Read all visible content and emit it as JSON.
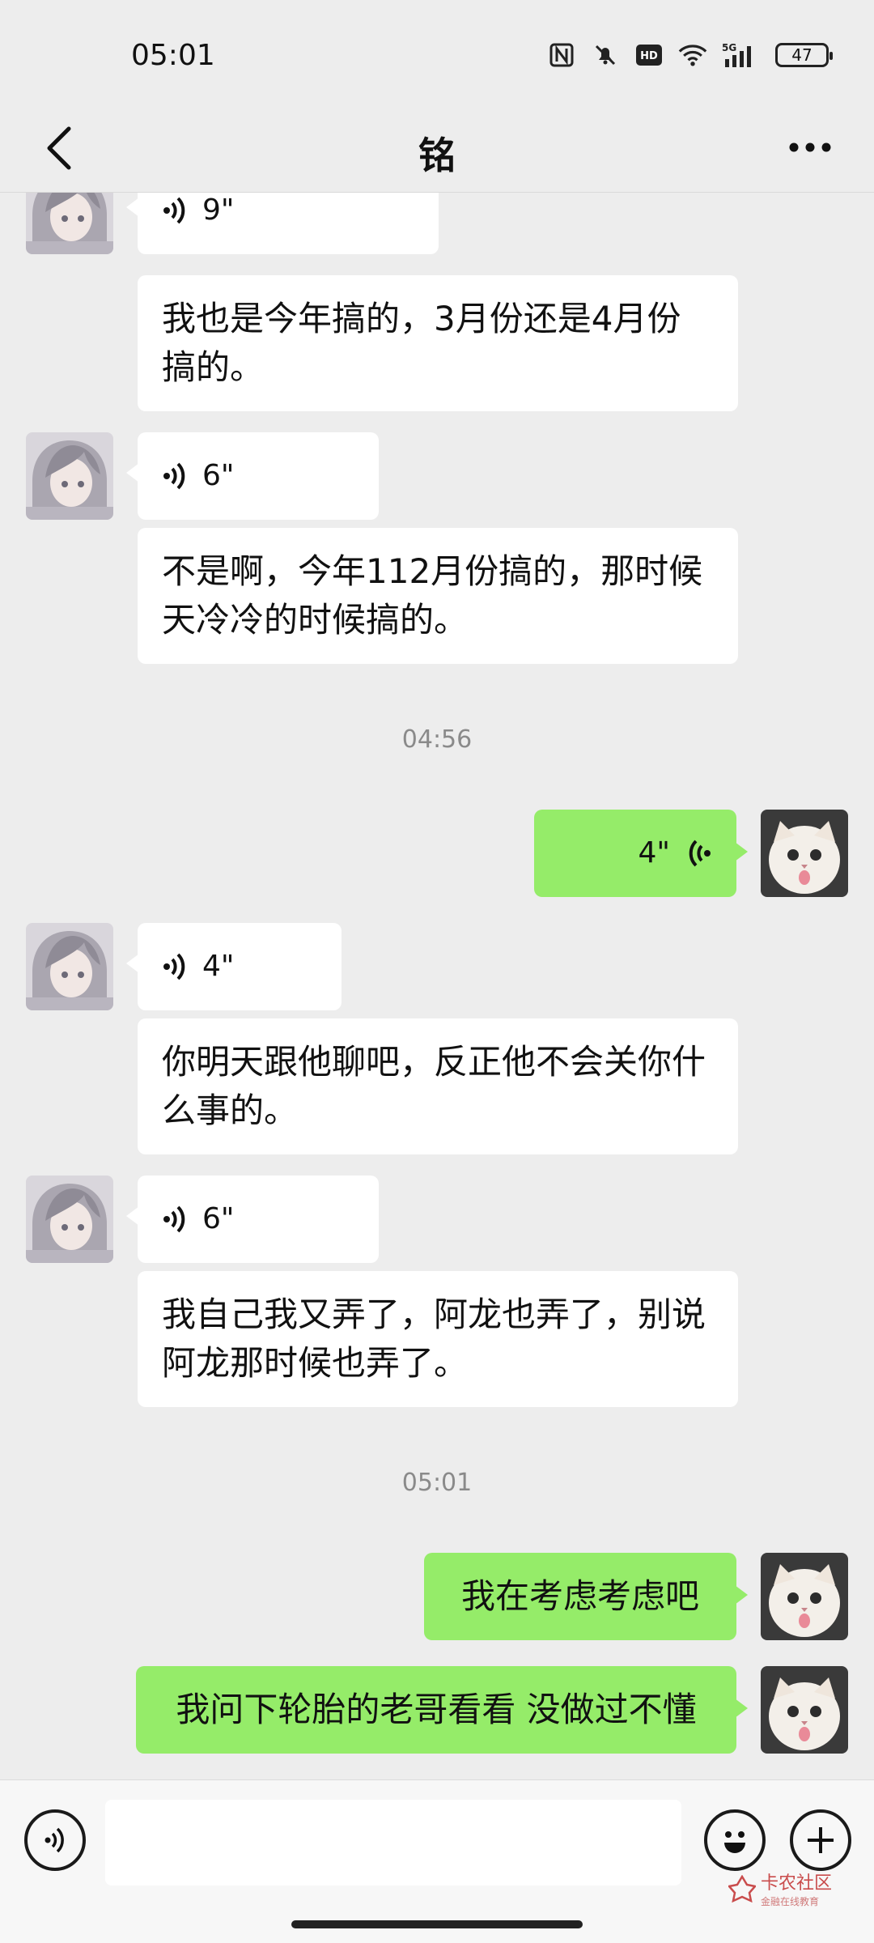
{
  "status_bar": {
    "time": "05:01",
    "battery": "47",
    "network": "5G",
    "icons": [
      "nfc-icon",
      "mute-icon",
      "hd-icon",
      "wifi-icon",
      "signal-icon",
      "battery-icon"
    ]
  },
  "header": {
    "title": "铭",
    "back_icon": "chevron-left-icon",
    "more_icon": "more-dots-icon"
  },
  "messages": [
    {
      "id": "m1",
      "side": "in",
      "type": "voice",
      "duration": "9\""
    },
    {
      "id": "m2",
      "side": "in",
      "type": "text",
      "text": "我也是今年搞的，3月份还是4月份搞的。"
    },
    {
      "id": "m3",
      "side": "in",
      "type": "voice",
      "duration": "6\""
    },
    {
      "id": "m4",
      "side": "in",
      "type": "text",
      "text": "不是啊，今年112月份搞的，那时候天冷冷的时候搞的。"
    },
    {
      "id": "t1",
      "type": "time",
      "text": "04:56"
    },
    {
      "id": "m5",
      "side": "out",
      "type": "voice",
      "duration": "4\""
    },
    {
      "id": "m6",
      "side": "in",
      "type": "voice",
      "duration": "4\""
    },
    {
      "id": "m7",
      "side": "in",
      "type": "text",
      "text": "你明天跟他聊吧，反正他不会关你什么事的。"
    },
    {
      "id": "m8",
      "side": "in",
      "type": "voice",
      "duration": "6\""
    },
    {
      "id": "m9",
      "side": "in",
      "type": "text",
      "text": "我自己我又弄了，阿龙也弄了，别说阿龙那时候也弄了。"
    },
    {
      "id": "t2",
      "type": "time",
      "text": "05:01"
    },
    {
      "id": "m10",
      "side": "out",
      "type": "text",
      "text": "我在考虑考虑吧"
    },
    {
      "id": "m11",
      "side": "out",
      "type": "text",
      "text": "我问下轮胎的老哥看看 没做过不懂"
    }
  ],
  "input_bar": {
    "voice_icon": "voice-input-icon",
    "emoji_icon": "emoji-icon",
    "plus_icon": "plus-icon",
    "placeholder": ""
  },
  "watermark": {
    "title": "卡农社区",
    "subtitle": "金融在线教育"
  },
  "colors": {
    "background": "#ededed",
    "bubble_in": "#ffffff",
    "bubble_out": "#95ec69",
    "time_text": "#8a8a8a"
  }
}
